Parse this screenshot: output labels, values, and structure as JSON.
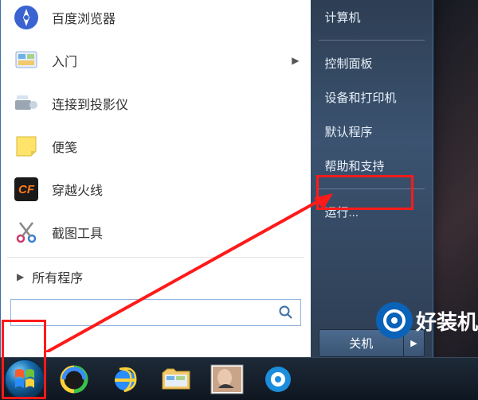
{
  "left_programs": [
    {
      "label": "百度浏览器",
      "icon": "compass",
      "has_submenu": false
    },
    {
      "label": "入门",
      "icon": "welcome",
      "has_submenu": true
    },
    {
      "label": "连接到投影仪",
      "icon": "projector",
      "has_submenu": false
    },
    {
      "label": "便笺",
      "icon": "sticky",
      "has_submenu": false
    },
    {
      "label": "穿越火线",
      "icon": "cf",
      "has_submenu": false
    },
    {
      "label": "截图工具",
      "icon": "snip",
      "has_submenu": false
    }
  ],
  "all_programs_label": "所有程序",
  "search_placeholder": "",
  "right_items_top": [
    "计算机",
    "控制面板",
    "设备和打印机",
    "默认程序",
    "帮助和支持"
  ],
  "right_run_label": "运行...",
  "shutdown_label": "关机",
  "watermark_text": "好装机"
}
